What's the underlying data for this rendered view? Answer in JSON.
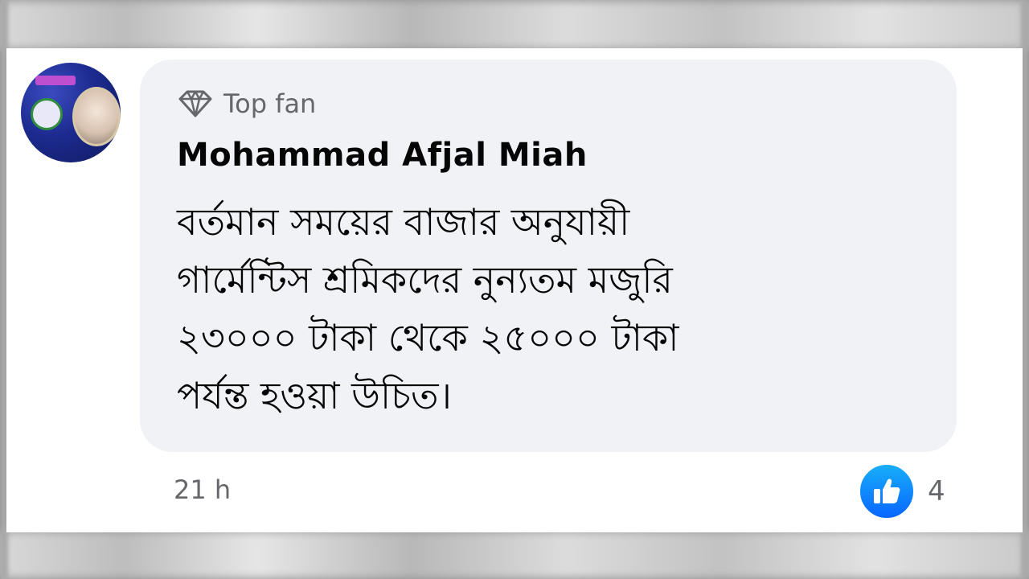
{
  "comment": {
    "badge_label": "Top fan",
    "badge_icon": "diamond-icon",
    "author_name": "Mohammad Afjal Miah",
    "text_lines": [
      "বর্তমান সময়ের বাজার অনুযায়ী",
      "গার্মেন্টিস শ্রমিকদের নুন্যতম মজুরি",
      "২৩০০০ টাকা থেকে ২৫০০০ টাকা",
      "পর্যন্ত হওয়া উচিত।"
    ],
    "timestamp": "21 h",
    "reaction_icon": "like-icon",
    "reaction_count": "4"
  },
  "colors": {
    "bubble_bg": "#f0f2f5",
    "secondary_text": "#65676b",
    "primary_text": "#050505",
    "like_blue": "#0866ff"
  }
}
